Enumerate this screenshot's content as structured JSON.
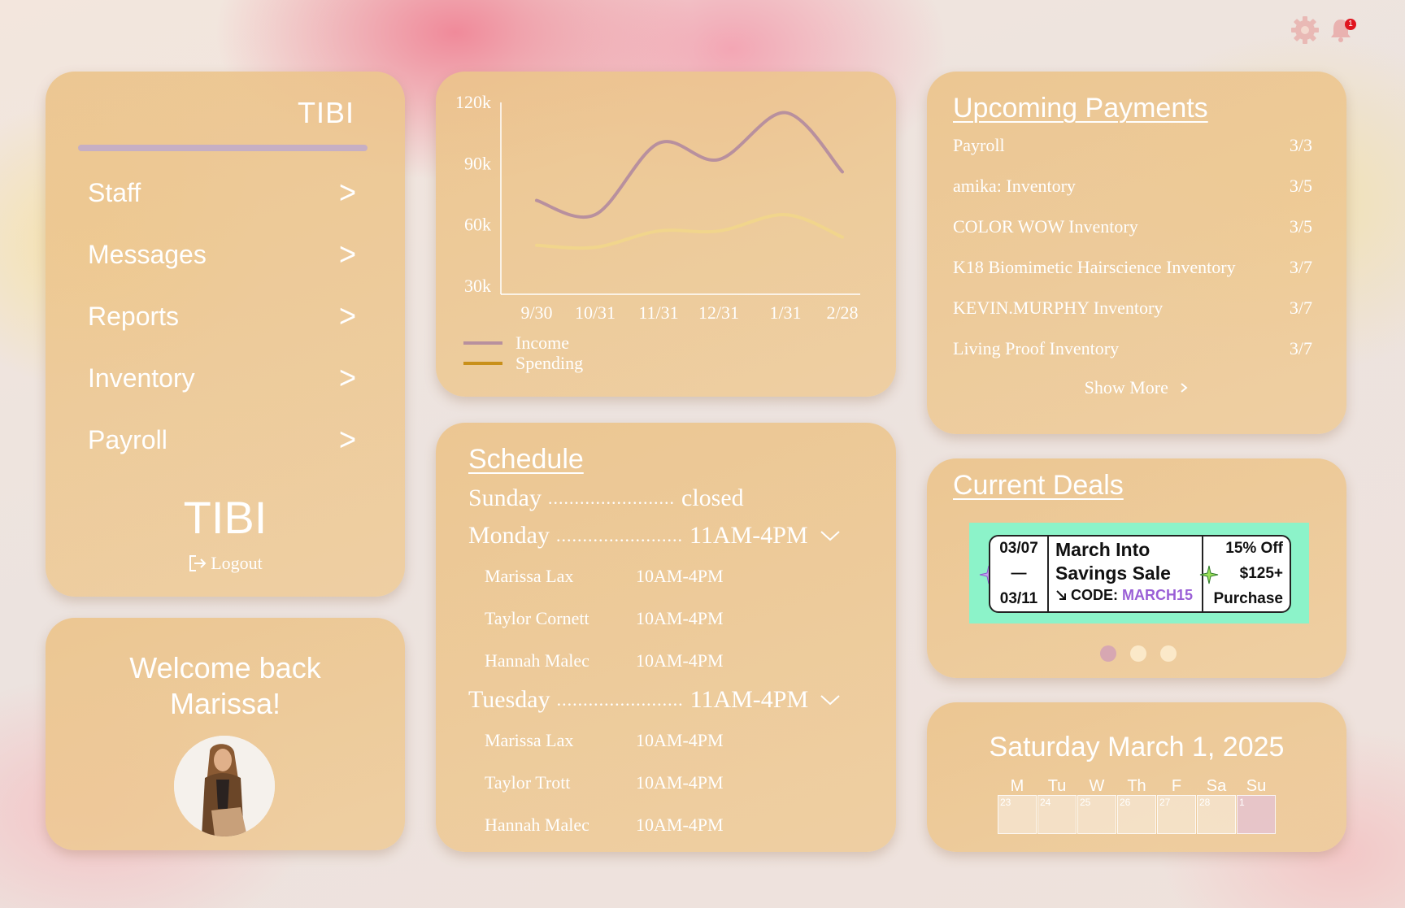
{
  "top_icons": {
    "settings_icon": "gear-icon",
    "notifications_icon": "bell-icon",
    "notification_count": "1"
  },
  "nav": {
    "brand": "TIBI",
    "items": [
      {
        "label": "Staff"
      },
      {
        "label": "Messages"
      },
      {
        "label": "Reports"
      },
      {
        "label": "Inventory"
      },
      {
        "label": "Payroll"
      }
    ],
    "chevron": ">",
    "brand_large": "TIBI",
    "logout_label": "Logout"
  },
  "welcome": {
    "line1": "Welcome back",
    "line2": "Marissa!"
  },
  "chart_data": {
    "type": "line",
    "x": [
      "9/30",
      "10/31",
      "11/31",
      "12/31",
      "1/31",
      "2/28"
    ],
    "yticks": [
      "120k",
      "90k",
      "60k",
      "30k"
    ],
    "ylim": [
      30000,
      120000
    ],
    "series": [
      {
        "name": "Income",
        "color": "#b8909e",
        "values": [
          72000,
          65000,
          100000,
          92000,
          115000,
          86000
        ]
      },
      {
        "name": "Spending",
        "color": "#c9901a",
        "values": [
          50000,
          49000,
          57000,
          57000,
          65000,
          54000
        ]
      }
    ],
    "legend_position": "bottom-left"
  },
  "schedule": {
    "title": "Schedule",
    "days": [
      {
        "day": "Sunday",
        "dots": "........................",
        "hours": "closed",
        "expandable": false,
        "staff": []
      },
      {
        "day": "Monday",
        "dots": "........................",
        "hours": "11AM-4PM",
        "expandable": true,
        "staff": [
          {
            "name": "Marissa Lax",
            "hours": "10AM-4PM"
          },
          {
            "name": "Taylor Cornett",
            "hours": "10AM-4PM"
          },
          {
            "name": "Hannah Malec",
            "hours": "10AM-4PM"
          }
        ]
      },
      {
        "day": "Tuesday",
        "dots": "........................",
        "hours": "11AM-4PM",
        "expandable": true,
        "staff": [
          {
            "name": "Marissa Lax",
            "hours": "10AM-4PM"
          },
          {
            "name": "Taylor Trott",
            "hours": "10AM-4PM"
          },
          {
            "name": "Hannah Malec",
            "hours": "10AM-4PM"
          }
        ]
      }
    ]
  },
  "payments": {
    "title": "Upcoming Payments",
    "items": [
      {
        "name": "Payroll",
        "date": "3/3"
      },
      {
        "name": "amika: Inventory",
        "date": "3/5"
      },
      {
        "name": "COLOR WOW Inventory",
        "date": "3/5"
      },
      {
        "name": "K18 Biomimetic Hairscience Inventory",
        "date": "3/7"
      },
      {
        "name": "KEVIN.MURPHY Inventory",
        "date": "3/7"
      },
      {
        "name": "Living Proof Inventory",
        "date": "3/7"
      }
    ],
    "show_more": "Show More"
  },
  "deals": {
    "title": "Current Deals",
    "banner_color": "#8cf3c9",
    "date_start": "03/07",
    "date_sep": "—",
    "date_end": "03/11",
    "name_line1": "March Into",
    "name_line2": "Savings Sale",
    "code_label": "CODE:",
    "code_value": "MARCH15",
    "offer_line1": "15% Off",
    "offer_line2": "$125+",
    "offer_line3": "Purchase",
    "carousel_active": 1,
    "carousel_total": 3
  },
  "calendar": {
    "title": "Saturday March 1, 2025",
    "weekdays": [
      "M",
      "Tu",
      "W",
      "Th",
      "F",
      "Sa",
      "Su"
    ],
    "days": [
      "23",
      "24",
      "25",
      "26",
      "27",
      "28",
      "1"
    ],
    "selected_day": "1"
  }
}
